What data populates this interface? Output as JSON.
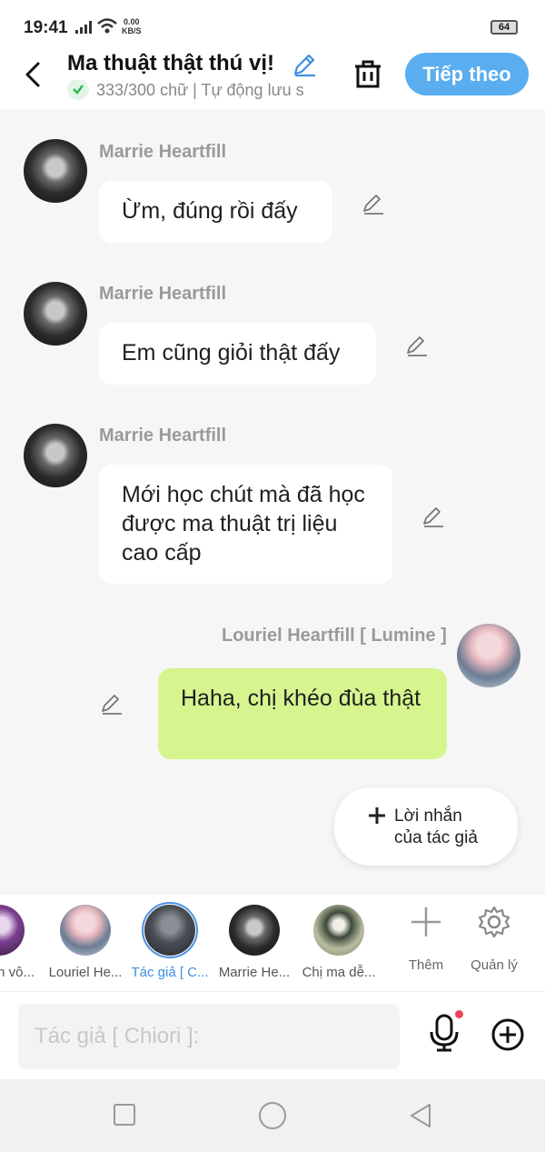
{
  "status_bar": {
    "time": "19:41",
    "net_speed": "0.00",
    "net_unit": "KB/S",
    "battery": "64"
  },
  "header": {
    "title": "Ma thuật thật thú vị!",
    "subtitle": "333/300 chữ | Tự động lưu s",
    "next_label": "Tiếp theo"
  },
  "messages": [
    {
      "sender": "Marrie Heartfill",
      "text": "Ừm, đúng rồi đấy",
      "side": "left"
    },
    {
      "sender": "Marrie Heartfill",
      "text": "Em cũng giỏi thật đấy",
      "side": "left"
    },
    {
      "sender": "Marrie Heartfill",
      "text": "Mới học chút mà đã học được ma thuật trị liệu cao cấp",
      "side": "left"
    },
    {
      "sender": "Louriel Heartfill [ Lumine ]",
      "text": "Haha, chị khéo đùa thật",
      "side": "right"
    }
  ],
  "author_note": {
    "line1": "Lời nhắn",
    "line2": "của tác giả"
  },
  "characters": [
    {
      "name": "n vô...",
      "avatar": "purple-hair"
    },
    {
      "name": "Louriel He...",
      "avatar": "pink-hair"
    },
    {
      "name": "Tác giả [ C...",
      "avatar": "dark-hair",
      "selected": true
    },
    {
      "name": "Marrie He...",
      "avatar": "dark-hair"
    },
    {
      "name": "Chị ma dễ...",
      "avatar": "ghost-girl"
    }
  ],
  "tools": {
    "add_label": "Thêm",
    "manage_label": "Quản lý"
  },
  "input": {
    "placeholder": "Tác giả [ Chiori ]:"
  },
  "colors": {
    "accent": "#5aaef0",
    "my_bubble": "#d6f58e",
    "selected": "#3d8fe0",
    "mic_dot": "#f0445a"
  }
}
